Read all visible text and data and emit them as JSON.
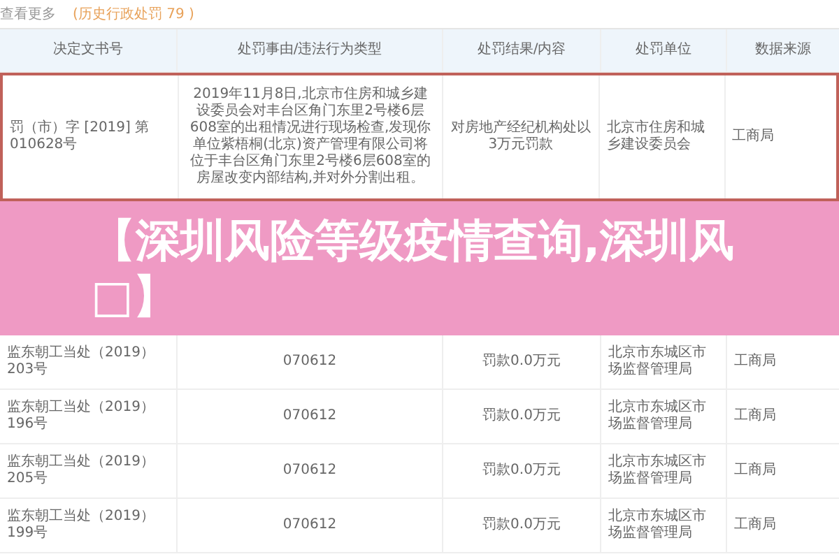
{
  "top_bar": {
    "more_link": "查看更多",
    "history_link": "(历史行政处罚 79 )"
  },
  "table": {
    "columns": [
      "决定文书号",
      "处罚事由/违法行为类型",
      "处罚结果/内容",
      "处罚单位",
      "数据来源"
    ],
    "rows": [
      {
        "selected": true,
        "cells": [
          "罚（市）字 [2019] 第010628号",
          "2019年11月8日,北京市住房和城乡建设委员会对丰台区角门东里2号楼6层608室的出租情况进行现场检查,发现你单位紫梧桐(北京)资产管理有限公司将位于丰台区角门东里2号楼6层608室的房屋改变内部结构,并对外分割出租。",
          "对房地产经纪机构处以3万元罚款",
          "北京市住房和城乡建设委员会",
          "工商局"
        ]
      },
      {
        "selected": false,
        "cells": [
          "监东朝工当处（2019）203号",
          "070612",
          "罚款0.0万元",
          "北京市东城区市场监督管理局",
          "工商局"
        ]
      },
      {
        "selected": false,
        "cells": [
          "监东朝工当处（2019）196号",
          "070612",
          "罚款0.0万元",
          "北京市东城区市场监督管理局",
          "工商局"
        ]
      },
      {
        "selected": false,
        "cells": [
          "监东朝工当处（2019）205号",
          "070612",
          "罚款0.0万元",
          "北京市东城区市场监督管理局",
          "工商局"
        ]
      },
      {
        "selected": false,
        "cells": [
          "监东朝工当处（2019）199号",
          "070612",
          "罚款0.0万元",
          "北京市东城区市场监督管理局",
          "工商局"
        ]
      }
    ]
  },
  "banner": {
    "title": "【深圳风险等级疫情查询,深圳风□】"
  }
}
